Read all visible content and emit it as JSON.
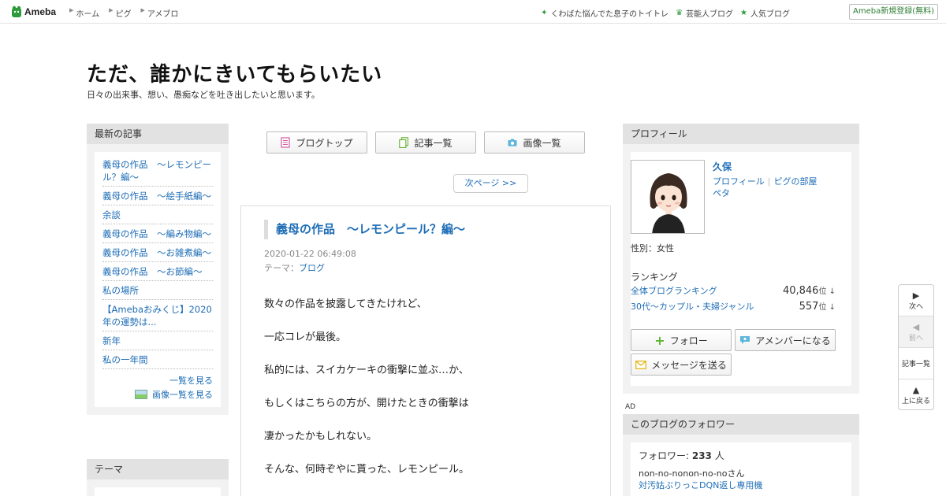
{
  "topbar": {
    "logo_text": "Ameba",
    "nav": [
      "ホーム",
      "ピグ",
      "アメブロ"
    ],
    "links": [
      {
        "icon": "sparkle-icon",
        "label": "くわばた悩んでた息子のトイトレ"
      },
      {
        "icon": "crown-icon",
        "label": "芸能人ブログ"
      },
      {
        "icon": "star-icon",
        "label": "人気ブログ"
      }
    ],
    "register_label": "Ameba新規登録(無料)",
    "accent": "#2e9b3b"
  },
  "blog": {
    "title": "ただ、誰かにきいてもらいたい",
    "description": "日々の出来事、想い、愚痴などを吐き出したいと思います。"
  },
  "recent": {
    "heading": "最新の記事",
    "entries": [
      "義母の作品　〜レモンピール？編〜",
      "義母の作品　〜絵手紙編〜",
      "余談",
      "義母の作品　〜編み物編〜",
      "義母の作品　〜お雑煮編〜",
      "義母の作品　〜お節編〜",
      "私の場所",
      "【Amebaおみくじ】2020年の運勢は...",
      "新年",
      "私の一年間"
    ],
    "more_label": "一覧を見る",
    "images_label": "画像一覧を見る"
  },
  "theme_box": {
    "heading": "テーマ"
  },
  "center_nav": {
    "blog_top": "ブログトップ",
    "entry_list": "記事一覧",
    "image_list": "画像一覧",
    "next_page": "次ページ >>"
  },
  "article": {
    "title": "義母の作品　〜レモンピール？編〜",
    "date": "2020-01-22 06:49:08",
    "theme_label": "テーマ：",
    "theme": "ブログ",
    "paragraphs": [
      "数々の作品を披露してきたけれど、",
      "一応コレが最後。",
      "私的には、スイカケーキの衝撃に並ぶ…か、",
      "もしくはこちらの方が、開けたときの衝撃は",
      "凄かったかもしれない。",
      "そんな、何時ぞやに貰った、レモンピール。"
    ]
  },
  "profile": {
    "heading": "プロフィール",
    "name": "久保",
    "link_profile": "プロフィール",
    "link_pig": "ピグの部屋",
    "link_peta": "ペタ",
    "gender": "性別：女性",
    "ranking_heading": "ランキング",
    "rankings": [
      {
        "label": "全体ブログランキング",
        "value": "40,846",
        "unit": "位 ↓"
      },
      {
        "label": "30代〜カップル・夫婦ジャンル",
        "value": "557",
        "unit": "位 ↓"
      }
    ],
    "follow_label": "フォロー",
    "member_label": "アメンバーになる",
    "message_label": "メッセージを送る"
  },
  "ad_label": "AD",
  "followers": {
    "heading": "このブログのフォロワー",
    "count_prefix": "フォロワー: ",
    "count": "233",
    "count_suffix": " 人",
    "first_name": "non-no-nonon-no-noさん",
    "first_blog": "対汚姑ぶりっこDQN返し専用機"
  },
  "sidenav": {
    "next": "次へ",
    "prev": "前へ",
    "entries": "記事一覧",
    "top": "上に戻る"
  }
}
